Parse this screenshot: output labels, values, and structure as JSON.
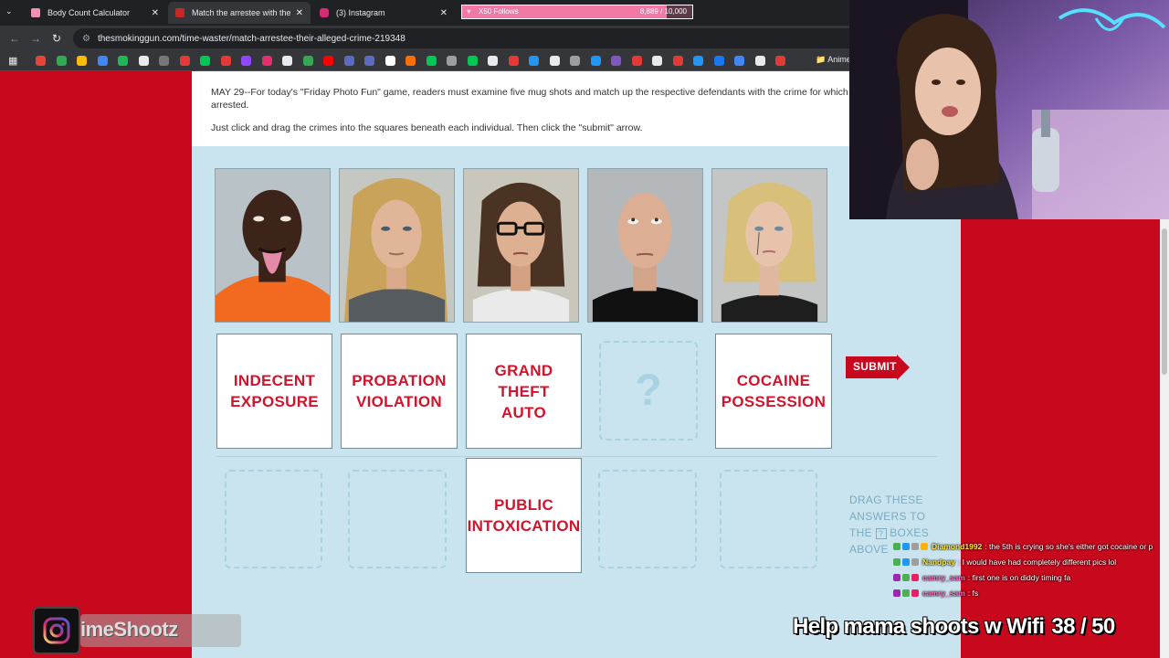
{
  "browser": {
    "tabs": [
      {
        "title": "Body Count Calculator",
        "color": "#f48fb1",
        "active": false
      },
      {
        "title": "Match the arrestee with their al",
        "color": "#c62828",
        "active": true
      },
      {
        "title": "(3) Instagram",
        "color": "#d62976",
        "active": false
      }
    ],
    "tab_close": "✕",
    "url": "thesmokinggun.com/time-waster/match-arrestee-their-alleged-crime-219348",
    "bookmarks_folder": "Anime",
    "nav": {
      "back": "←",
      "forward": "→",
      "reload": "↻"
    }
  },
  "subgoal": {
    "label": "X50 Follows",
    "count": "8,889 / 10,000",
    "progress": 0.8889,
    "heart": "♥"
  },
  "article": {
    "line1": "MAY 29--For today's \"Friday Photo Fun\" game, readers must examine five mug shots and match up the respective defendants with the crime for which they were",
    "line2": "arrested.",
    "line3": "Just click and drag the crimes into the squares beneath each individual. Then click the \"submit\" arrow."
  },
  "game": {
    "mugshots": [
      {
        "id": "1",
        "desc": "man tongue out, orange jumpsuit"
      },
      {
        "id": "2",
        "desc": "blonde woman"
      },
      {
        "id": "3",
        "desc": "woman with glasses"
      },
      {
        "id": "4",
        "desc": "bald man looking up"
      },
      {
        "id": "5",
        "desc": "blonde woman crying"
      }
    ],
    "placed": [
      {
        "line1": "INDECENT",
        "line2": "EXPOSURE",
        "line3": ""
      },
      {
        "line1": "PROBATION",
        "line2": "VIOLATION",
        "line3": ""
      },
      {
        "line1": "GRAND",
        "line2": "THEFT",
        "line3": "AUTO"
      },
      {
        "empty": true,
        "symbol": "?"
      },
      {
        "line1": "COCAINE",
        "line2": "POSSESSION",
        "line3": ""
      }
    ],
    "answers": [
      {
        "empty": true
      },
      {
        "empty": true
      },
      {
        "line1": "PUBLIC",
        "line2": "INTOXICATION"
      },
      {
        "empty": true
      },
      {
        "empty": true
      }
    ],
    "submit_label": "SUBMIT",
    "hint": {
      "line1": "DRAG THESE",
      "line2": "ANSWERS TO",
      "line3a": "THE",
      "icon": "?",
      "line3b": "BOXES",
      "line4": "ABOVE"
    }
  },
  "chat": [
    {
      "user": "Diamond1992",
      "text": ": the 5th is crying so she's either got cocaine or p",
      "badges": [
        "#4caf50",
        "#2196f3",
        "#9e9e9e",
        "#ffb300"
      ]
    },
    {
      "user": "Nandpay",
      "text": ": I would have had completely different pics lol",
      "badges": [
        "#4caf50",
        "#2196f3",
        "#9e9e9e"
      ]
    },
    {
      "user": "camry_sam",
      "text": ": first one is on diddy timing fa",
      "badges": [
        "#9c27b0",
        "#4caf50",
        "#e91e63"
      ]
    },
    {
      "user": "camry_sam",
      "text": ": fs",
      "badges": [
        "#9c27b0",
        "#4caf50",
        "#e91e63"
      ]
    }
  ],
  "goal": {
    "text": "Help mama shoots w Wifi",
    "count": "38 / 50"
  },
  "instagram": {
    "handle": "imeShootz"
  }
}
